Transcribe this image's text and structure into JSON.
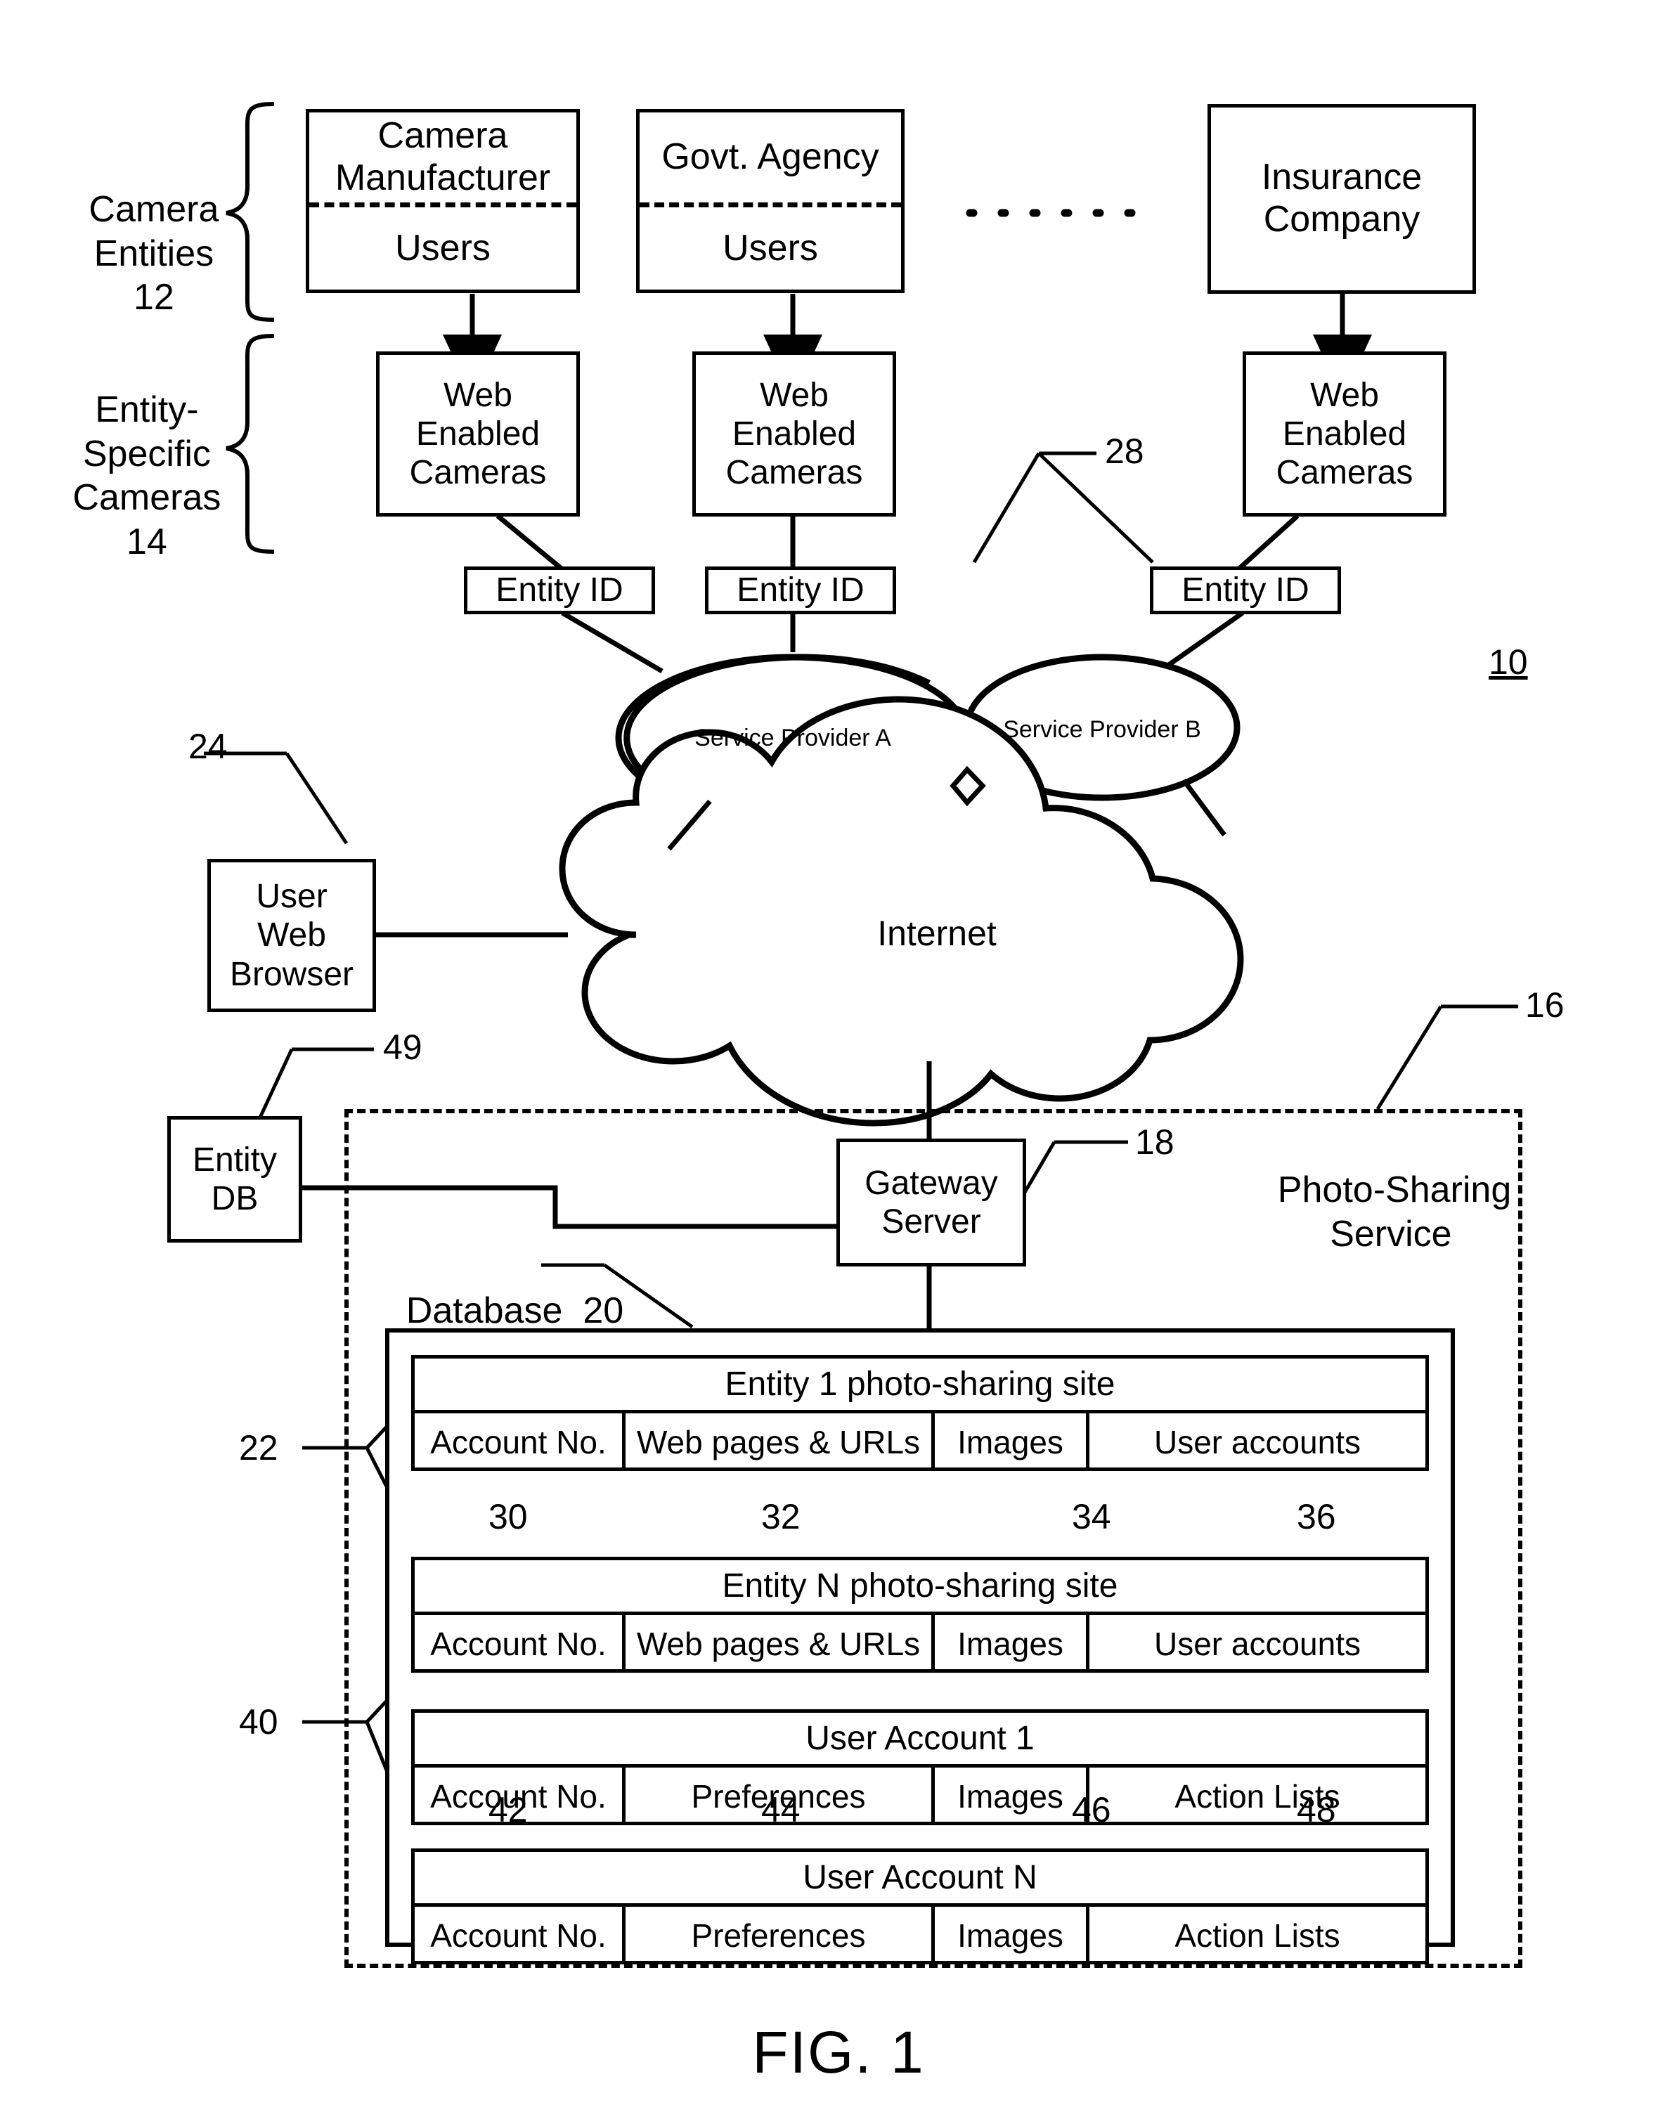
{
  "figure": {
    "caption": "FIG. 1",
    "system_ref": "10"
  },
  "groups": {
    "camera_entities": {
      "label_line1": "Camera",
      "label_line2": "Entities",
      "ref": "12"
    },
    "entity_specific_cameras": {
      "label_line1": "Entity-",
      "label_line2": "Specific",
      "label_line3": "Cameras",
      "ref": "14"
    }
  },
  "entities": [
    {
      "name_line1": "Camera",
      "name_line2": "Manufacturer",
      "users": "Users"
    },
    {
      "name_line1": "Govt.",
      "name_line2": "Agency",
      "users": "Users"
    },
    {
      "name_line1": "Insurance",
      "name_line2": "Company",
      "users": ""
    }
  ],
  "cameras": [
    {
      "line1": "Web",
      "line2": "Enabled",
      "line3": "Cameras"
    },
    {
      "line1": "Web",
      "line2": "Enabled",
      "line3": "Cameras"
    },
    {
      "line1": "Web",
      "line2": "Enabled",
      "line3": "Cameras"
    }
  ],
  "entity_ids": [
    {
      "label": "Entity ID"
    },
    {
      "label": "Entity ID"
    },
    {
      "label": "Entity ID"
    }
  ],
  "entity_id_ref": "28",
  "service_providers": [
    {
      "label": "Service Provider A"
    },
    {
      "label": "Service Provider B"
    }
  ],
  "internet": {
    "label": "Internet"
  },
  "user_web_browser": {
    "line1": "User",
    "line2": "Web",
    "line3": "Browser",
    "ref": "24"
  },
  "entity_db": {
    "line1": "Entity",
    "line2": "DB",
    "ref": "49"
  },
  "gateway_server": {
    "line1": "Gateway",
    "line2": "Server",
    "ref": "18"
  },
  "photo_sharing_service": {
    "line1": "Photo-Sharing",
    "line2": "Service",
    "ref": "16"
  },
  "database": {
    "label": "Database",
    "ref": "20",
    "entity_sites_ref": "22",
    "user_accounts_ref": "40",
    "entity_tables": [
      {
        "title": "Entity 1 photo-sharing site",
        "columns": [
          "Account  No.",
          "Web pages & URLs",
          "Images",
          "User accounts"
        ],
        "column_refs": [
          "30",
          "32",
          "34",
          "36"
        ]
      },
      {
        "title": "Entity N photo-sharing site",
        "columns": [
          "Account  No.",
          "Web pages & URLs",
          "Images",
          "User accounts"
        ],
        "column_refs": []
      }
    ],
    "user_account_tables": [
      {
        "title": "User Account 1",
        "columns": [
          "Account  No.",
          "Preferences",
          "Images",
          "Action Lists"
        ],
        "column_refs": [
          "42",
          "44",
          "46",
          "48"
        ]
      },
      {
        "title": "User Account N",
        "columns": [
          "Account  No.",
          "Preferences",
          "Images",
          "Action Lists"
        ],
        "column_refs": []
      }
    ]
  },
  "colors": {
    "ink": "#000000",
    "paper": "#ffffff"
  }
}
